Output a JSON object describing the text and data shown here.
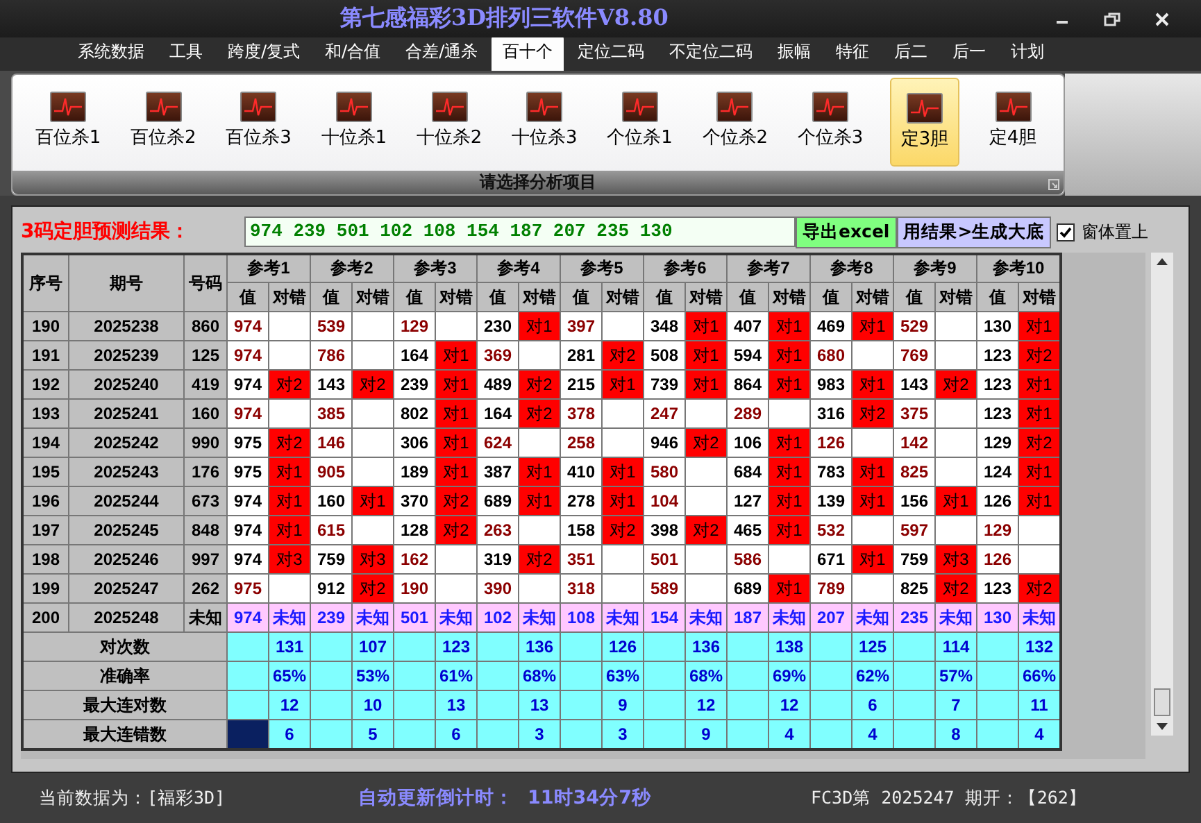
{
  "window": {
    "title": "第七感福彩3D排列三软件V8.80"
  },
  "menu": [
    {
      "label": "系统数据",
      "selected": false
    },
    {
      "label": "工具",
      "selected": false
    },
    {
      "label": "跨度/复式",
      "selected": false
    },
    {
      "label": "和/合值",
      "selected": false
    },
    {
      "label": "合差/通杀",
      "selected": false
    },
    {
      "label": "百十个",
      "selected": true
    },
    {
      "label": "定位二码",
      "selected": false
    },
    {
      "label": "不定位二码",
      "selected": false
    },
    {
      "label": "振幅",
      "selected": false
    },
    {
      "label": "特征",
      "selected": false
    },
    {
      "label": "后二",
      "selected": false
    },
    {
      "label": "后一",
      "selected": false
    },
    {
      "label": "计划",
      "selected": false
    }
  ],
  "ribbon": {
    "items": [
      {
        "label": "百位杀1",
        "selected": false
      },
      {
        "label": "百位杀2",
        "selected": false
      },
      {
        "label": "百位杀3",
        "selected": false
      },
      {
        "label": "十位杀1",
        "selected": false
      },
      {
        "label": "十位杀2",
        "selected": false
      },
      {
        "label": "十位杀3",
        "selected": false
      },
      {
        "label": "个位杀1",
        "selected": false
      },
      {
        "label": "个位杀2",
        "selected": false
      },
      {
        "label": "个位杀3",
        "selected": false
      },
      {
        "label": "定3胆",
        "selected": true
      },
      {
        "label": "定4胆",
        "selected": false
      }
    ],
    "caption": "请选择分析项目"
  },
  "result": {
    "label": "3码定胆预测结果：",
    "value": "974 239 501 102 108 154 187 207 235 130",
    "buttons": [
      {
        "label": "导出excel",
        "kind": "export"
      },
      {
        "label": "用结果>生成大底",
        "kind": "generate"
      }
    ],
    "stay_on_top": {
      "label": "窗体置上",
      "checked": true
    }
  },
  "table": {
    "columns": [
      "序号",
      "期号",
      "号码"
    ],
    "groups": [
      {
        "label": "参考1",
        "sub": [
          "值",
          "对错"
        ]
      },
      {
        "label": "参考2",
        "sub": [
          "值",
          "对错"
        ]
      },
      {
        "label": "参考3",
        "sub": [
          "值",
          "对错"
        ]
      },
      {
        "label": "参考4",
        "sub": [
          "值",
          "对错"
        ]
      },
      {
        "label": "参考5",
        "sub": [
          "值",
          "对错"
        ]
      },
      {
        "label": "参考6",
        "sub": [
          "值",
          "对错"
        ]
      },
      {
        "label": "参考7",
        "sub": [
          "值",
          "对错"
        ]
      },
      {
        "label": "参考8",
        "sub": [
          "值",
          "对错"
        ]
      },
      {
        "label": "参考9",
        "sub": [
          "值",
          "对错"
        ]
      },
      {
        "label": "参考10",
        "sub": [
          "值",
          "对错"
        ]
      }
    ],
    "rows": [
      {
        "kind": "history",
        "no": "190",
        "issue": "2025238",
        "number": "860",
        "refs": [
          {
            "value": "974",
            "hit": false
          },
          {
            "value": "539",
            "hit": false
          },
          {
            "value": "129",
            "hit": false
          },
          {
            "value": "230",
            "hit": true,
            "result": "对1"
          },
          {
            "value": "397",
            "hit": false
          },
          {
            "value": "348",
            "hit": true,
            "result": "对1"
          },
          {
            "value": "407",
            "hit": true,
            "result": "对1"
          },
          {
            "value": "469",
            "hit": true,
            "result": "对1"
          },
          {
            "value": "529",
            "hit": false
          },
          {
            "value": "130",
            "hit": true,
            "result": "对1"
          }
        ]
      },
      {
        "kind": "history",
        "no": "191",
        "issue": "2025239",
        "number": "125",
        "refs": [
          {
            "value": "974",
            "hit": false
          },
          {
            "value": "786",
            "hit": false
          },
          {
            "value": "164",
            "hit": true,
            "result": "对1"
          },
          {
            "value": "369",
            "hit": false
          },
          {
            "value": "281",
            "hit": true,
            "result": "对2"
          },
          {
            "value": "508",
            "hit": true,
            "result": "对1"
          },
          {
            "value": "594",
            "hit": true,
            "result": "对1"
          },
          {
            "value": "680",
            "hit": false
          },
          {
            "value": "769",
            "hit": false
          },
          {
            "value": "123",
            "hit": true,
            "result": "对2"
          }
        ]
      },
      {
        "kind": "history",
        "no": "192",
        "issue": "2025240",
        "number": "419",
        "refs": [
          {
            "value": "974",
            "hit": true,
            "result": "对2"
          },
          {
            "value": "143",
            "hit": true,
            "result": "对2"
          },
          {
            "value": "239",
            "hit": true,
            "result": "对1"
          },
          {
            "value": "489",
            "hit": true,
            "result": "对2"
          },
          {
            "value": "215",
            "hit": true,
            "result": "对1"
          },
          {
            "value": "739",
            "hit": true,
            "result": "对1"
          },
          {
            "value": "864",
            "hit": true,
            "result": "对1"
          },
          {
            "value": "983",
            "hit": true,
            "result": "对1"
          },
          {
            "value": "143",
            "hit": true,
            "result": "对2"
          },
          {
            "value": "123",
            "hit": true,
            "result": "对1"
          }
        ]
      },
      {
        "kind": "history",
        "no": "193",
        "issue": "2025241",
        "number": "160",
        "refs": [
          {
            "value": "974",
            "hit": false
          },
          {
            "value": "385",
            "hit": false
          },
          {
            "value": "802",
            "hit": true,
            "result": "对1"
          },
          {
            "value": "164",
            "hit": true,
            "result": "对2"
          },
          {
            "value": "378",
            "hit": false
          },
          {
            "value": "247",
            "hit": false
          },
          {
            "value": "289",
            "hit": false
          },
          {
            "value": "316",
            "hit": true,
            "result": "对2"
          },
          {
            "value": "375",
            "hit": false
          },
          {
            "value": "123",
            "hit": true,
            "result": "对1"
          }
        ]
      },
      {
        "kind": "history",
        "no": "194",
        "issue": "2025242",
        "number": "990",
        "refs": [
          {
            "value": "975",
            "hit": true,
            "result": "对2"
          },
          {
            "value": "146",
            "hit": false
          },
          {
            "value": "306",
            "hit": true,
            "result": "对1"
          },
          {
            "value": "624",
            "hit": false
          },
          {
            "value": "258",
            "hit": false
          },
          {
            "value": "946",
            "hit": true,
            "result": "对2"
          },
          {
            "value": "106",
            "hit": true,
            "result": "对1"
          },
          {
            "value": "126",
            "hit": false
          },
          {
            "value": "142",
            "hit": false
          },
          {
            "value": "129",
            "hit": true,
            "result": "对2"
          }
        ]
      },
      {
        "kind": "history",
        "no": "195",
        "issue": "2025243",
        "number": "176",
        "refs": [
          {
            "value": "975",
            "hit": true,
            "result": "对1"
          },
          {
            "value": "905",
            "hit": false
          },
          {
            "value": "189",
            "hit": true,
            "result": "对1"
          },
          {
            "value": "387",
            "hit": true,
            "result": "对1"
          },
          {
            "value": "410",
            "hit": true,
            "result": "对1"
          },
          {
            "value": "580",
            "hit": false
          },
          {
            "value": "684",
            "hit": true,
            "result": "对1"
          },
          {
            "value": "783",
            "hit": true,
            "result": "对1"
          },
          {
            "value": "825",
            "hit": false
          },
          {
            "value": "124",
            "hit": true,
            "result": "对1"
          }
        ]
      },
      {
        "kind": "history",
        "no": "196",
        "issue": "2025244",
        "number": "673",
        "refs": [
          {
            "value": "974",
            "hit": true,
            "result": "对1"
          },
          {
            "value": "160",
            "hit": true,
            "result": "对1"
          },
          {
            "value": "370",
            "hit": true,
            "result": "对2"
          },
          {
            "value": "689",
            "hit": true,
            "result": "对1"
          },
          {
            "value": "278",
            "hit": true,
            "result": "对1"
          },
          {
            "value": "104",
            "hit": false
          },
          {
            "value": "127",
            "hit": true,
            "result": "对1"
          },
          {
            "value": "139",
            "hit": true,
            "result": "对1"
          },
          {
            "value": "156",
            "hit": true,
            "result": "对1"
          },
          {
            "value": "126",
            "hit": true,
            "result": "对1"
          }
        ]
      },
      {
        "kind": "history",
        "no": "197",
        "issue": "2025245",
        "number": "848",
        "refs": [
          {
            "value": "974",
            "hit": true,
            "result": "对1"
          },
          {
            "value": "615",
            "hit": false
          },
          {
            "value": "128",
            "hit": true,
            "result": "对2"
          },
          {
            "value": "263",
            "hit": false
          },
          {
            "value": "158",
            "hit": true,
            "result": "对2"
          },
          {
            "value": "398",
            "hit": true,
            "result": "对2"
          },
          {
            "value": "465",
            "hit": true,
            "result": "对1"
          },
          {
            "value": "532",
            "hit": false
          },
          {
            "value": "597",
            "hit": false
          },
          {
            "value": "129",
            "hit": false
          }
        ]
      },
      {
        "kind": "history",
        "no": "198",
        "issue": "2025246",
        "number": "997",
        "refs": [
          {
            "value": "974",
            "hit": true,
            "result": "对3"
          },
          {
            "value": "759",
            "hit": true,
            "result": "对3"
          },
          {
            "value": "162",
            "hit": false
          },
          {
            "value": "319",
            "hit": true,
            "result": "对2"
          },
          {
            "value": "351",
            "hit": false
          },
          {
            "value": "501",
            "hit": false
          },
          {
            "value": "586",
            "hit": false
          },
          {
            "value": "671",
            "hit": true,
            "result": "对1"
          },
          {
            "value": "759",
            "hit": true,
            "result": "对3"
          },
          {
            "value": "126",
            "hit": false
          }
        ]
      },
      {
        "kind": "history",
        "no": "199",
        "issue": "2025247",
        "number": "262",
        "refs": [
          {
            "value": "975",
            "hit": false
          },
          {
            "value": "912",
            "hit": true,
            "result": "对2"
          },
          {
            "value": "190",
            "hit": false
          },
          {
            "value": "390",
            "hit": false
          },
          {
            "value": "318",
            "hit": false
          },
          {
            "value": "589",
            "hit": false
          },
          {
            "value": "689",
            "hit": true,
            "result": "对1"
          },
          {
            "value": "789",
            "hit": false
          },
          {
            "value": "825",
            "hit": true,
            "result": "对2"
          },
          {
            "value": "123",
            "hit": true,
            "result": "对2"
          }
        ]
      },
      {
        "kind": "pending",
        "no": "200",
        "issue": "2025248",
        "number": "未知",
        "refs": [
          {
            "value": "974",
            "result": "未知"
          },
          {
            "value": "239",
            "result": "未知"
          },
          {
            "value": "501",
            "result": "未知"
          },
          {
            "value": "102",
            "result": "未知"
          },
          {
            "value": "108",
            "result": "未知"
          },
          {
            "value": "154",
            "result": "未知"
          },
          {
            "value": "187",
            "result": "未知"
          },
          {
            "value": "207",
            "result": "未知"
          },
          {
            "value": "235",
            "result": "未知"
          },
          {
            "value": "130",
            "result": "未知"
          }
        ]
      }
    ],
    "stats": [
      {
        "label": "对次数",
        "selected": false,
        "values": [
          "131",
          "107",
          "123",
          "136",
          "126",
          "136",
          "138",
          "125",
          "114",
          "132"
        ]
      },
      {
        "label": "准确率",
        "selected": false,
        "values": [
          "65%",
          "53%",
          "61%",
          "68%",
          "63%",
          "68%",
          "69%",
          "62%",
          "57%",
          "66%"
        ]
      },
      {
        "label": "最大连对数",
        "selected": false,
        "values": [
          "12",
          "10",
          "13",
          "13",
          "9",
          "12",
          "12",
          "6",
          "7",
          "11"
        ]
      },
      {
        "label": "最大连错数",
        "selected": true,
        "values": [
          "6",
          "5",
          "6",
          "3",
          "3",
          "9",
          "4",
          "4",
          "8",
          "4"
        ]
      }
    ]
  },
  "status_bar": {
    "source": "当前数据为：[福彩3D]",
    "countdown_label": "自动更新倒计时：",
    "countdown": "11时34分7秒",
    "latest": "FC3D第 2025247 期开：【262】"
  }
}
